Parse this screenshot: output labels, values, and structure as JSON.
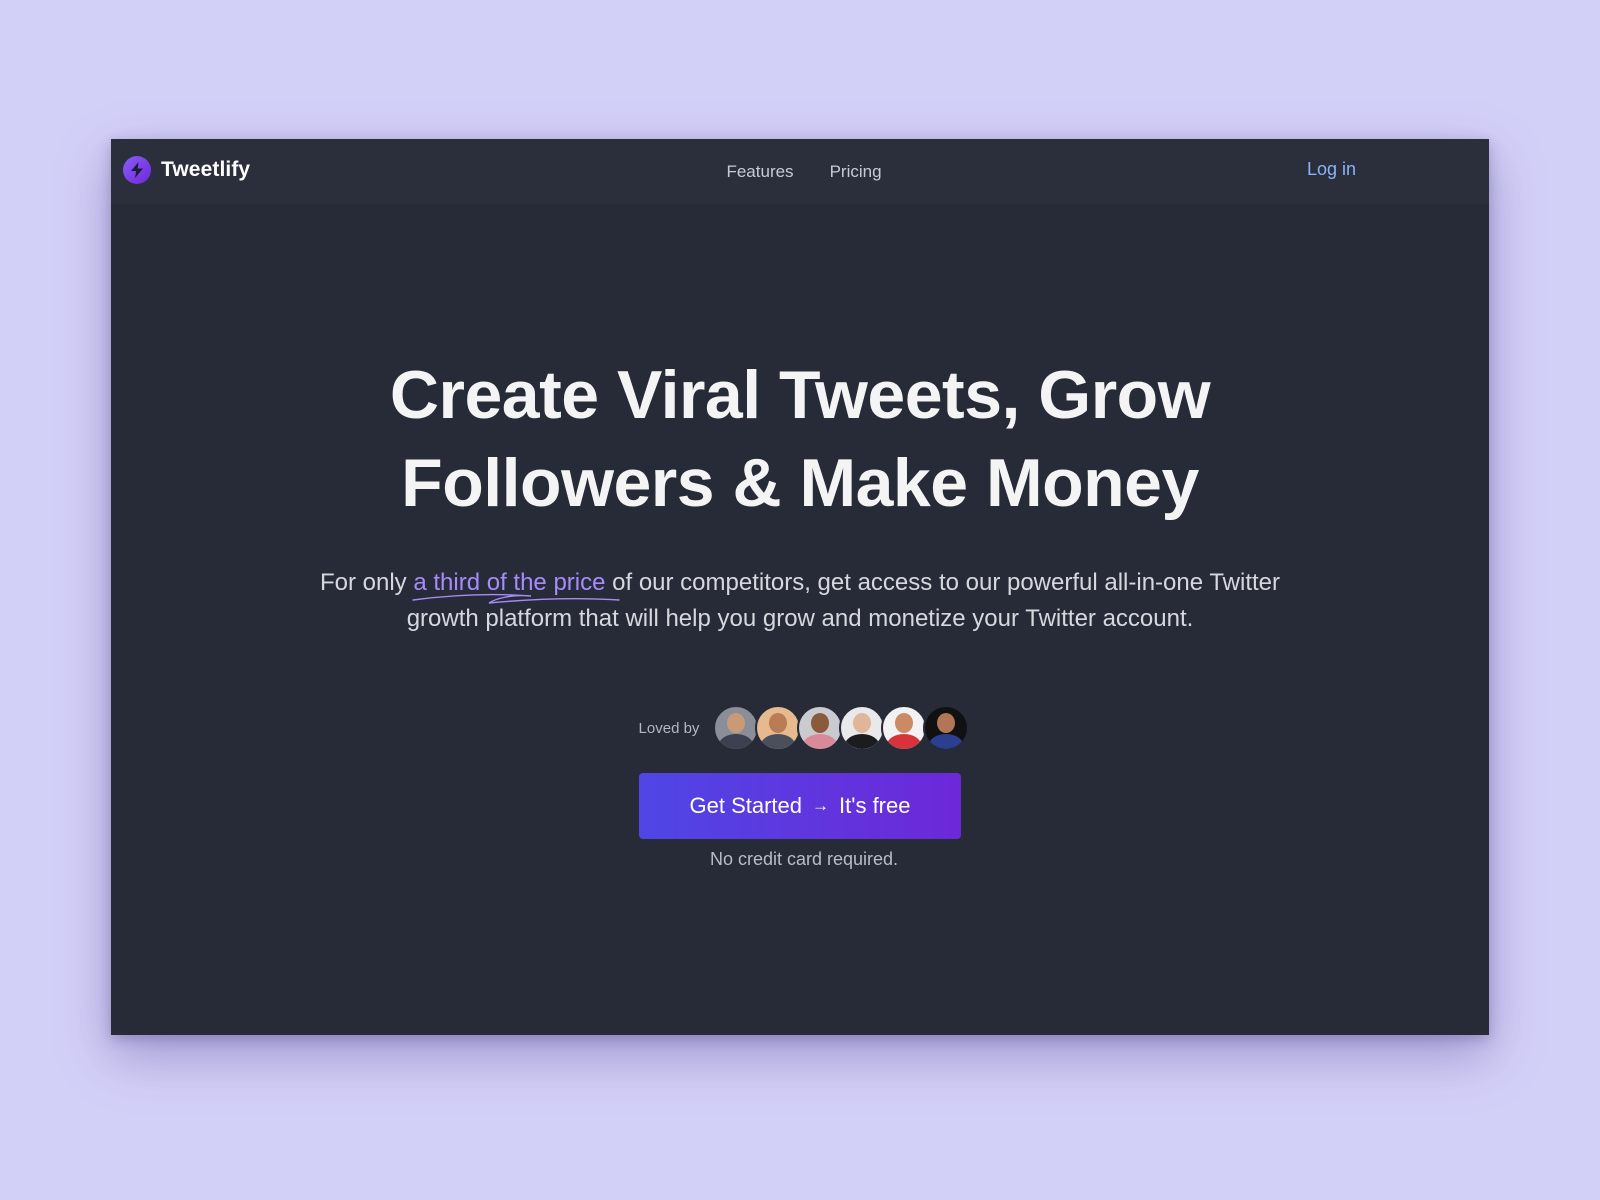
{
  "brand": {
    "name": "Tweetlify",
    "logo_icon": "lightning-bolt-icon",
    "logo_color": "#7c3aed"
  },
  "nav": {
    "links": [
      {
        "label": "Features"
      },
      {
        "label": "Pricing"
      }
    ],
    "login_label": "Log in"
  },
  "hero": {
    "title_line1": "Create Viral Tweets, Grow",
    "title_line2": "Followers & Make Money",
    "subtitle_prefix": "For only ",
    "subtitle_highlight": "a third of the price",
    "subtitle_suffix": " of our competitors, get access to our powerful all-in-one Twitter growth platform that will help you grow and monetize your Twitter account."
  },
  "social_proof": {
    "label": "Loved by",
    "avatars": [
      {
        "name": "avatar-1"
      },
      {
        "name": "avatar-2"
      },
      {
        "name": "avatar-3"
      },
      {
        "name": "avatar-4"
      },
      {
        "name": "avatar-5"
      },
      {
        "name": "avatar-6"
      }
    ]
  },
  "cta": {
    "label": "Get Started",
    "arrow": "→",
    "suffix": "It's free",
    "note": "No credit card required.",
    "gradient_start": "#4f46e5",
    "gradient_end": "#6d28d9"
  },
  "colors": {
    "page_background": "#d3d0f8",
    "app_background": "#272b38",
    "link_accent": "#8ab4f8",
    "highlight": "#a78bfa"
  }
}
